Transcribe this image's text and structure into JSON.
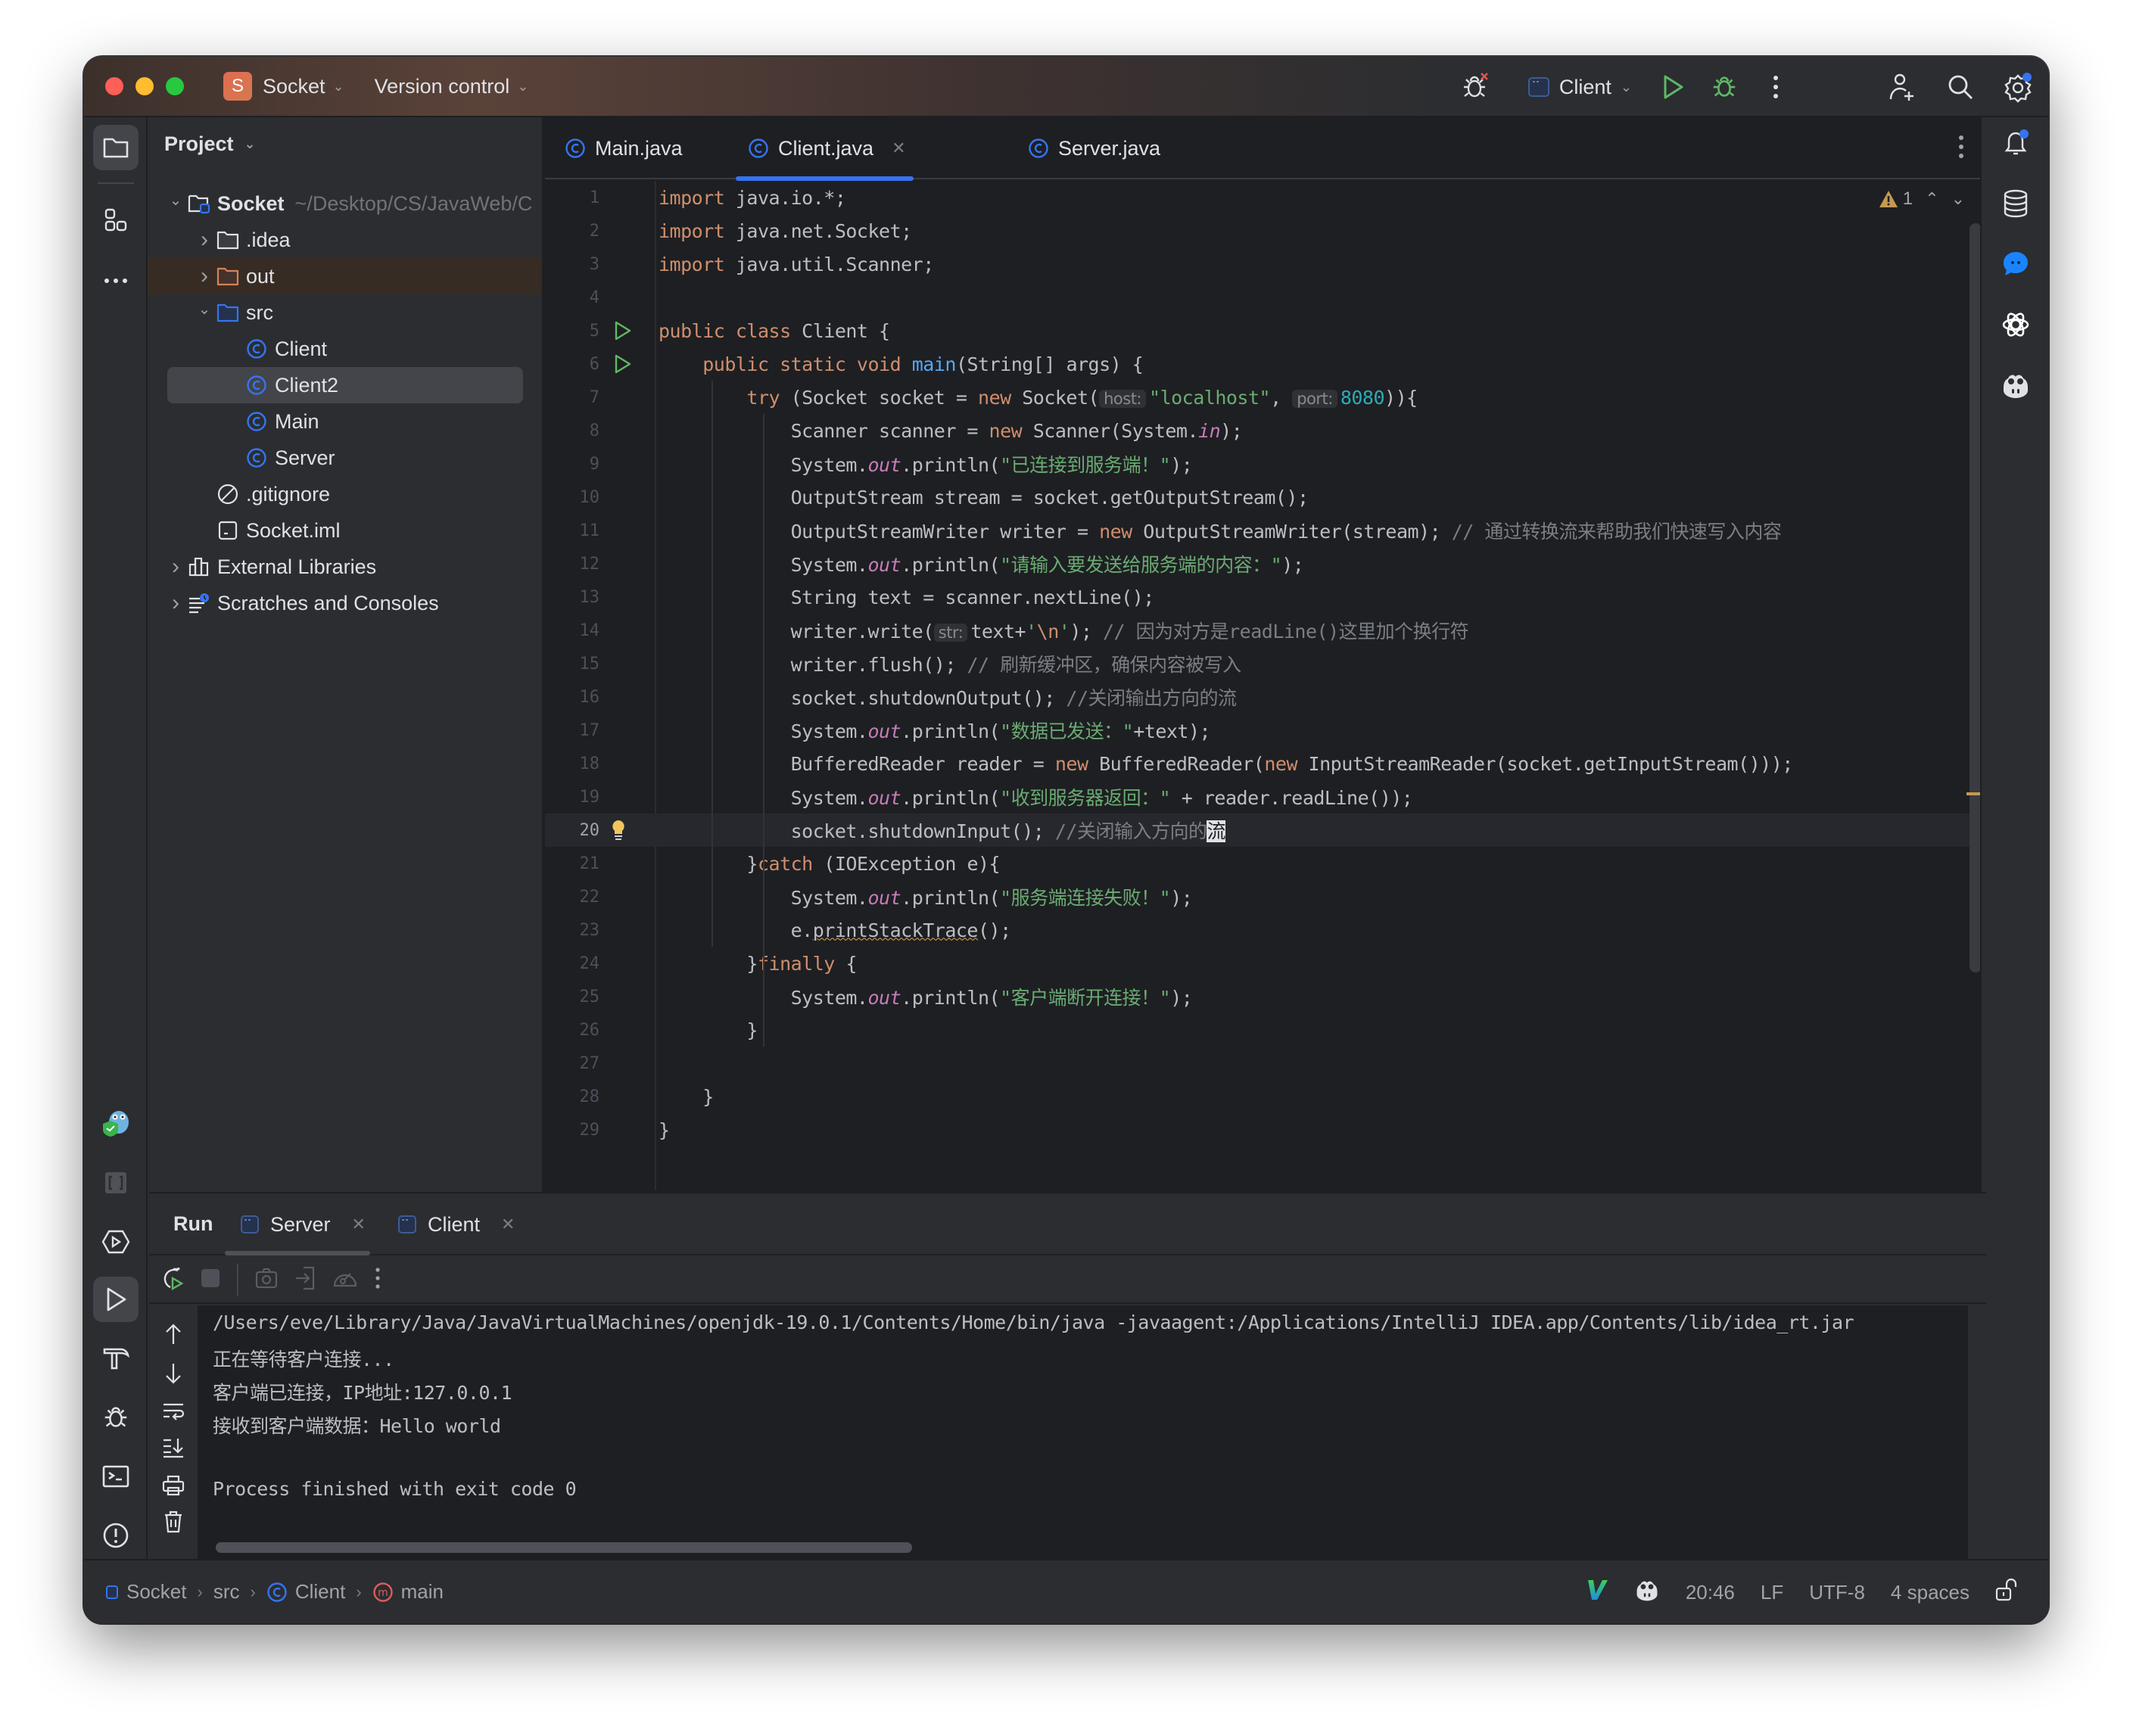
{
  "titlebar": {
    "project_badge": "S",
    "project_name": "Socket",
    "vcs_label": "Version control",
    "run_config": "Client",
    "icons": [
      "debug-disabled-icon",
      "run-icon",
      "debug-icon",
      "more-icon",
      "add-user-icon",
      "search-icon",
      "settings-icon"
    ]
  },
  "left_strip": {
    "top_icons": [
      "project-folder-icon",
      "structure-icon",
      "more-tools-icon"
    ],
    "bottom_icons": [
      "go-plugin-icon",
      "bracket-icon",
      "services-icon",
      "run-icon",
      "build-icon",
      "debug-icon",
      "terminal-icon",
      "problems-icon",
      "git-icon"
    ]
  },
  "project": {
    "header": "Project",
    "tree": [
      {
        "label": "Socket",
        "suffix": "~/Desktop/CS/JavaWeb/C",
        "icon": "module-folder-icon",
        "expanded": true,
        "depth": 0,
        "bold": true
      },
      {
        "label": ".idea",
        "icon": "folder-icon",
        "expanded": false,
        "depth": 1
      },
      {
        "label": "out",
        "icon": "excluded-folder-icon",
        "expanded": false,
        "depth": 1,
        "excluded": true
      },
      {
        "label": "src",
        "icon": "source-folder-icon",
        "expanded": true,
        "depth": 1
      },
      {
        "label": "Client",
        "icon": "java-class-icon",
        "depth": 2
      },
      {
        "label": "Client2",
        "icon": "java-class-icon",
        "depth": 2,
        "selected": true
      },
      {
        "label": "Main",
        "icon": "java-class-icon",
        "depth": 2
      },
      {
        "label": "Server",
        "icon": "java-class-icon",
        "depth": 2
      },
      {
        "label": ".gitignore",
        "icon": "ignore-file-icon",
        "depth": 1
      },
      {
        "label": "Socket.iml",
        "icon": "iml-file-icon",
        "depth": 1
      },
      {
        "label": "External Libraries",
        "icon": "libraries-icon",
        "expanded": false,
        "depth": 0
      },
      {
        "label": "Scratches and Consoles",
        "icon": "scratches-icon",
        "expanded": false,
        "depth": 0
      }
    ]
  },
  "editor": {
    "tabs": [
      {
        "label": "Main.java",
        "active": false
      },
      {
        "label": "Client.java",
        "active": true
      },
      {
        "label": "Server.java",
        "active": false
      }
    ],
    "inspection": {
      "warnings": "1"
    },
    "current_line": 20,
    "lines": [
      {
        "n": "1",
        "html": "<span class=\"kw\">import</span> java.io.*;"
      },
      {
        "n": "2",
        "html": "<span class=\"kw\">import</span> java.net.Socket;"
      },
      {
        "n": "3",
        "html": "<span class=\"kw\">import</span> java.util.Scanner;"
      },
      {
        "n": "4",
        "html": ""
      },
      {
        "n": "5",
        "html": "<span class=\"kw\">public class</span> Client {",
        "run": true
      },
      {
        "n": "6",
        "html": "    <span class=\"kw\">public static void</span> <span class=\"fn\">main</span>(String[] args) {",
        "run": true
      },
      {
        "n": "7",
        "html": "        <span class=\"kw\">try</span> (Socket socket = <span class=\"kw\">new</span> Socket(<span class=\"hint\">host:</span><span class=\"str\">\"localhost\"</span>, <span class=\"hint\">port:</span><span class=\"num\">8080</span>)){"
      },
      {
        "n": "8",
        "html": "            Scanner scanner = <span class=\"kw\">new</span> Scanner(System.<span class=\"st\">in</span>);"
      },
      {
        "n": "9",
        "html": "            System.<span class=\"st\">out</span>.println(<span class=\"str\">\"已连接到服务端！\"</span>);"
      },
      {
        "n": "10",
        "html": "            OutputStream stream = socket.getOutputStream();"
      },
      {
        "n": "11",
        "html": "            OutputStreamWriter writer = <span class=\"kw\">new</span> OutputStreamWriter(stream); <span class=\"cm\">// 通过转换流来帮助我们快速写入内容</span>"
      },
      {
        "n": "12",
        "html": "            System.<span class=\"st\">out</span>.println(<span class=\"str\">\"请输入要发送给服务端的内容：\"</span>);"
      },
      {
        "n": "13",
        "html": "            String text = scanner.nextLine();"
      },
      {
        "n": "14",
        "html": "            writer.write(<span class=\"hint\">str:</span>text+<span class=\"str\">'</span><span class=\"kw\">\\n</span><span class=\"str\">'</span>); <span class=\"cm\">// 因为对方是readLine()这里加个换行符</span>"
      },
      {
        "n": "15",
        "html": "            writer.flush(); <span class=\"cm\">// 刷新缓冲区，确保内容被写入</span>"
      },
      {
        "n": "16",
        "html": "            socket.shutdownOutput(); <span class=\"cm\">//关闭输出方向的流</span>"
      },
      {
        "n": "17",
        "html": "            System.<span class=\"st\">out</span>.println(<span class=\"str\">\"数据已发送：\"</span>+text);"
      },
      {
        "n": "18",
        "html": "            BufferedReader reader = <span class=\"kw\">new</span> BufferedReader(<span class=\"kw\">new</span> InputStreamReader(socket.getInputStream()));"
      },
      {
        "n": "19",
        "html": "            System.<span class=\"st\">out</span>.println(<span class=\"str\">\"收到服务器返回：\"</span> + reader.readLine());"
      },
      {
        "n": "20",
        "html": "            socket.shutdownInput(); <span class=\"cm\">//关闭输入方向的</span><span class=\"caret-sel\">流</span>",
        "bulb": true
      },
      {
        "n": "21",
        "html": "        }<span class=\"kw\">catch</span> (IOException e){"
      },
      {
        "n": "22",
        "html": "            System.<span class=\"st\">out</span>.println(<span class=\"str\">\"服务端连接失败！\"</span>);"
      },
      {
        "n": "23",
        "html": "            e.<span class=\"warn-under\">printStackTrace</span>();"
      },
      {
        "n": "24",
        "html": "        }<span class=\"kw\">finally</span> {"
      },
      {
        "n": "25",
        "html": "            System.<span class=\"st\">out</span>.println(<span class=\"str\">\"客户端断开连接！\"</span>);"
      },
      {
        "n": "26",
        "html": "        }"
      },
      {
        "n": "27",
        "html": ""
      },
      {
        "n": "28",
        "html": "    }"
      },
      {
        "n": "29",
        "html": "}"
      }
    ]
  },
  "right_strip": {
    "icons": [
      "notifications-icon",
      "database-icon",
      "ai-chat-icon",
      "openai-icon",
      "copilot-icon"
    ]
  },
  "run_panel": {
    "title": "Run",
    "tabs": [
      {
        "label": "Server",
        "active": true
      },
      {
        "label": "Client",
        "active": false
      }
    ],
    "toolbar_icons": [
      "rerun-icon",
      "stop-icon",
      "screenshot-icon",
      "restore-layout-icon",
      "profiler-icon",
      "more-icon"
    ],
    "side_icons": [
      "scroll-up-icon",
      "scroll-down-icon",
      "soft-wrap-icon",
      "scroll-to-end-icon",
      "print-icon",
      "clear-icon"
    ],
    "console": [
      "/Users/eve/Library/Java/JavaVirtualMachines/openjdk-19.0.1/Contents/Home/bin/java -javaagent:/Applications/IntelliJ IDEA.app/Contents/lib/idea_rt.jar",
      "正在等待客户连接...",
      "客户端已连接，IP地址:127.0.0.1",
      "接收到客户端数据：Hello world",
      "",
      "Process finished with exit code 0"
    ]
  },
  "statusbar": {
    "breadcrumbs": [
      {
        "label": "Socket",
        "icon": "module-icon"
      },
      {
        "label": "src",
        "icon": ""
      },
      {
        "label": "Client",
        "icon": "java-class-icon"
      },
      {
        "label": "main",
        "icon": "method-icon"
      }
    ],
    "cursor_position": "20:46",
    "line_separator": "LF",
    "encoding": "UTF-8",
    "indent": "4 spaces"
  },
  "colors": {
    "accent": "#3574f0",
    "keyword": "#cf8e6d",
    "string": "#6aab73",
    "number": "#2aacb8",
    "function": "#56a8f5",
    "static_field": "#c77dbb",
    "comment": "#7a7e85",
    "run_green": "#5fb865",
    "warning": "#c39a52"
  }
}
